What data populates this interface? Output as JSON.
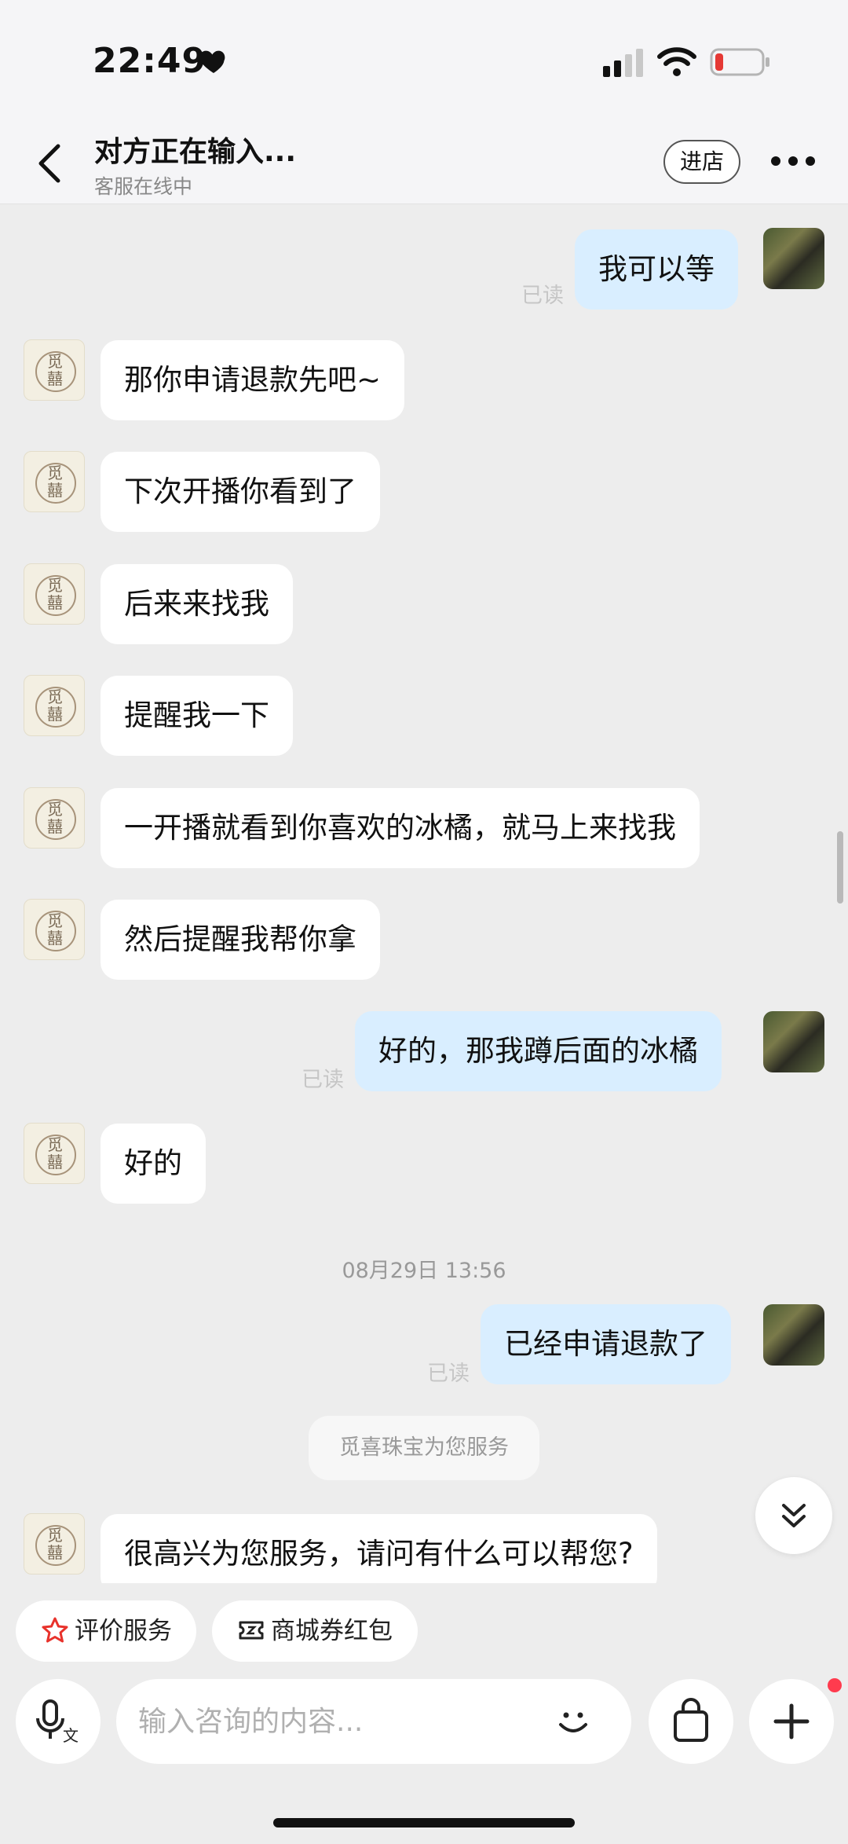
{
  "status_bar": {
    "time": "22:49",
    "heart_icon": "heart-icon",
    "signal_icon": "cellular-signal-icon",
    "wifi_icon": "wifi-icon",
    "battery_icon": "battery-low-icon",
    "battery_color": "#e53935"
  },
  "header": {
    "title": "对方正在输入...",
    "subtitle": "客服在线中",
    "store_button": "进店",
    "back_icon": "chevron-left-icon",
    "more_icon": "more-dots-icon"
  },
  "chat": {
    "messages": [
      {
        "side": "out",
        "text": "我可以等",
        "read": "已读"
      },
      {
        "side": "in",
        "text": "那你申请退款先吧~"
      },
      {
        "side": "in",
        "text": "下次开播你看到了"
      },
      {
        "side": "in",
        "text": "后来来找我"
      },
      {
        "side": "in",
        "text": "提醒我一下"
      },
      {
        "side": "in",
        "text": "一开播就看到你喜欢的冰橘，就马上来找我"
      },
      {
        "side": "in",
        "text": "然后提醒我帮你拿"
      },
      {
        "side": "out",
        "text": "好的，那我蹲后面的冰橘",
        "read": "已读"
      },
      {
        "side": "in",
        "text": "好的"
      },
      {
        "side": "timestamp",
        "text": "08月29日 13:56"
      },
      {
        "side": "out",
        "text": "已经申请退款了",
        "read": "已读"
      },
      {
        "side": "system",
        "text": "觅喜珠宝为您服务"
      },
      {
        "side": "in",
        "text": "很高兴为您服务，请问有什么可以帮您?"
      }
    ],
    "shop_avatar_text": "觅\n囍"
  },
  "quick_actions": {
    "rate_service": "评价服务",
    "coupons": "商城券红包",
    "rate_icon": "star-icon",
    "coupon_icon": "coupon-icon",
    "rate_icon_color": "#e8322b"
  },
  "input": {
    "placeholder": "输入咨询的内容...",
    "voice_icon": "voice-input-icon",
    "voice_badge": "文",
    "emoji_icon": "smiley-icon",
    "bag_icon": "shopping-bag-icon",
    "plus_icon": "plus-icon"
  }
}
